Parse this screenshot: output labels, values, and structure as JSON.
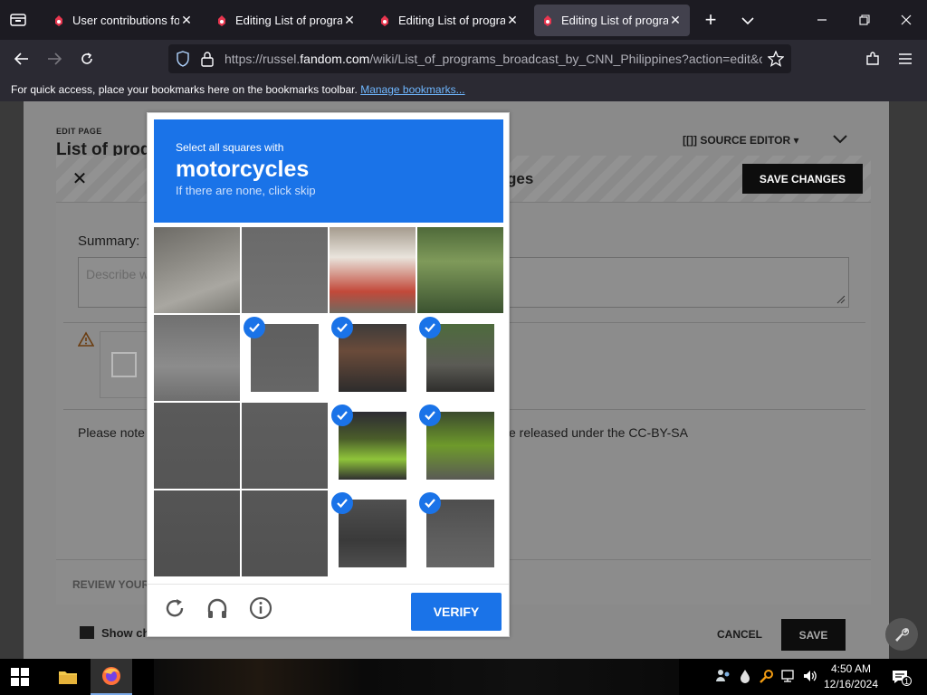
{
  "browser": {
    "tabs": [
      {
        "title": "User contributions for",
        "active": false
      },
      {
        "title": "Editing List of program",
        "active": false
      },
      {
        "title": "Editing List of program",
        "active": false
      },
      {
        "title": "Editing List of program",
        "active": true
      }
    ],
    "url": {
      "prefix": "https://russel.",
      "domain": "fandom.com",
      "path": "/wiki/List_of_programs_broadcast_by_CNN_Philippines?action=edit&ol"
    },
    "bookmarks_bar": {
      "text": "For quick access, place your bookmarks here on the bookmarks toolbar.",
      "link": "Manage bookmarks..."
    }
  },
  "page": {
    "edit_page_label": "EDIT PAGE",
    "title_fragment": "List of prog",
    "source_editor_label": "[[]] SOURCE EDITOR ▾",
    "dialog_title_fragment": "ges",
    "save_changes_label": "SAVE CHANGES",
    "summary_label": "Summary:",
    "summary_placeholder": "Describe w",
    "please_note": "Please note",
    "released_text": "e released under the CC-BY-SA",
    "review_label": "REVIEW YOUR",
    "show_changes": "Show ch",
    "cancel_label": "CANCEL",
    "save_label": "SAVE"
  },
  "captcha": {
    "instruction": "Select all squares with",
    "target": "motorcycles",
    "hint": "If there are none, click skip",
    "verify_label": "VERIFY",
    "selected": [
      false,
      false,
      false,
      false,
      false,
      true,
      true,
      true,
      false,
      false,
      true,
      true,
      false,
      false,
      true,
      true
    ],
    "colors": {
      "header": "#1a73e8",
      "check": "#1a73e8"
    }
  },
  "taskbar": {
    "time": "4:50 AM",
    "date": "12/16/2024",
    "notification_count": "1"
  }
}
